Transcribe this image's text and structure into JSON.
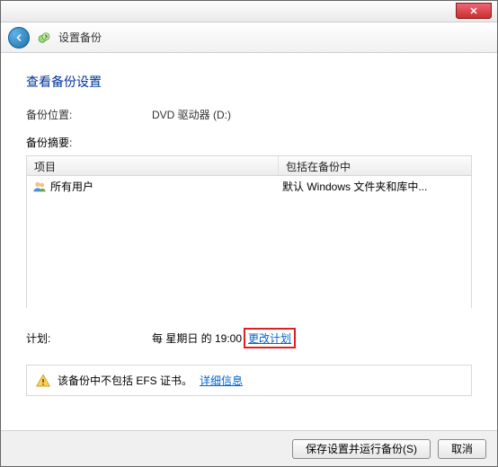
{
  "titlebar": {
    "close_glyph": "✕"
  },
  "nav": {
    "title": "设置备份"
  },
  "heading": "查看备份设置",
  "location": {
    "label": "备份位置:",
    "value": "DVD 驱动器 (D:)"
  },
  "summary_label": "备份摘要:",
  "table": {
    "col_item": "项目",
    "col_included": "包括在备份中",
    "rows": [
      {
        "item": "所有用户",
        "included": "默认 Windows 文件夹和库中..."
      }
    ]
  },
  "schedule": {
    "label": "计划:",
    "value": "每 星期日 的 19:00",
    "change_link": "更改计划"
  },
  "notice": {
    "text": "该备份中不包括 EFS 证书。",
    "details_link": "详细信息"
  },
  "footer": {
    "save": "保存设置并运行备份(S)",
    "cancel": "取消"
  }
}
